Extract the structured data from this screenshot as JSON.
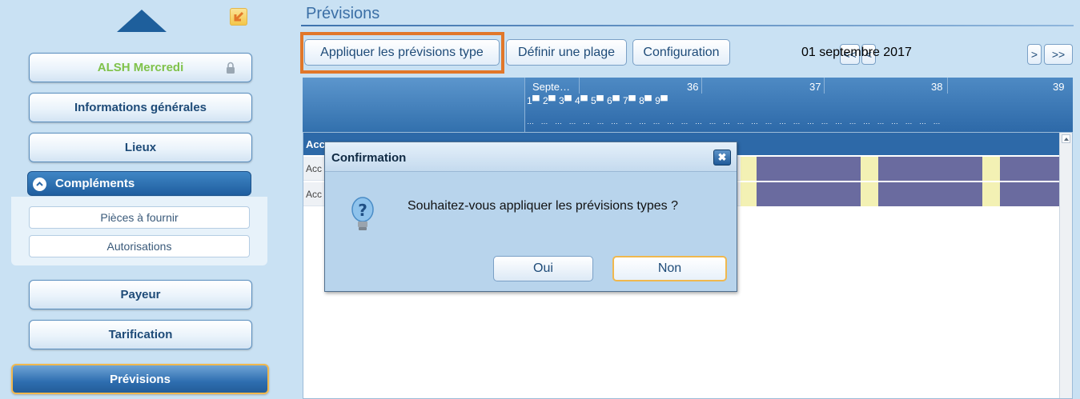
{
  "sidebar": {
    "items": [
      {
        "label": "ALSH Mercredi"
      },
      {
        "label": "Informations générales"
      },
      {
        "label": "Lieux"
      }
    ],
    "group": {
      "label": "Compléments",
      "subitems": [
        {
          "label": "Pièces à fournir"
        },
        {
          "label": "Autorisations"
        }
      ]
    },
    "items_after": [
      {
        "label": "Payeur"
      },
      {
        "label": "Tarification"
      },
      {
        "label": "Prévisions"
      }
    ]
  },
  "main": {
    "title": "Prévisions",
    "toolbar": {
      "apply": "Appliquer les prévisions type",
      "range": "Définir une plage",
      "config": "Configuration"
    },
    "date_nav": {
      "first": "<<",
      "prev": "<",
      "date": "01 septembre 2017",
      "next": ">",
      "last": ">>"
    },
    "grid": {
      "month": "Septe…",
      "weeks": [
        "36",
        "37",
        "38",
        "39"
      ],
      "days": "1▀ 2▀ 3▀ 4▀ 5▀ 6▀ 7▀ 8▀ 9▀",
      "header_row": "Acc",
      "rows": [
        {
          "label": "Acc"
        },
        {
          "label": "Acc"
        }
      ]
    }
  },
  "dialog": {
    "title": "Confirmation",
    "close": "✖",
    "message": "Souhaitez-vous appliquer les prévisions types ?",
    "yes": "Oui",
    "no": "Non"
  },
  "colors": {
    "accent": "#2d69a8",
    "highlight": "#e1772a",
    "bar_purple": "#6a6b9f",
    "bar_yellow": "#f3f1b4"
  }
}
